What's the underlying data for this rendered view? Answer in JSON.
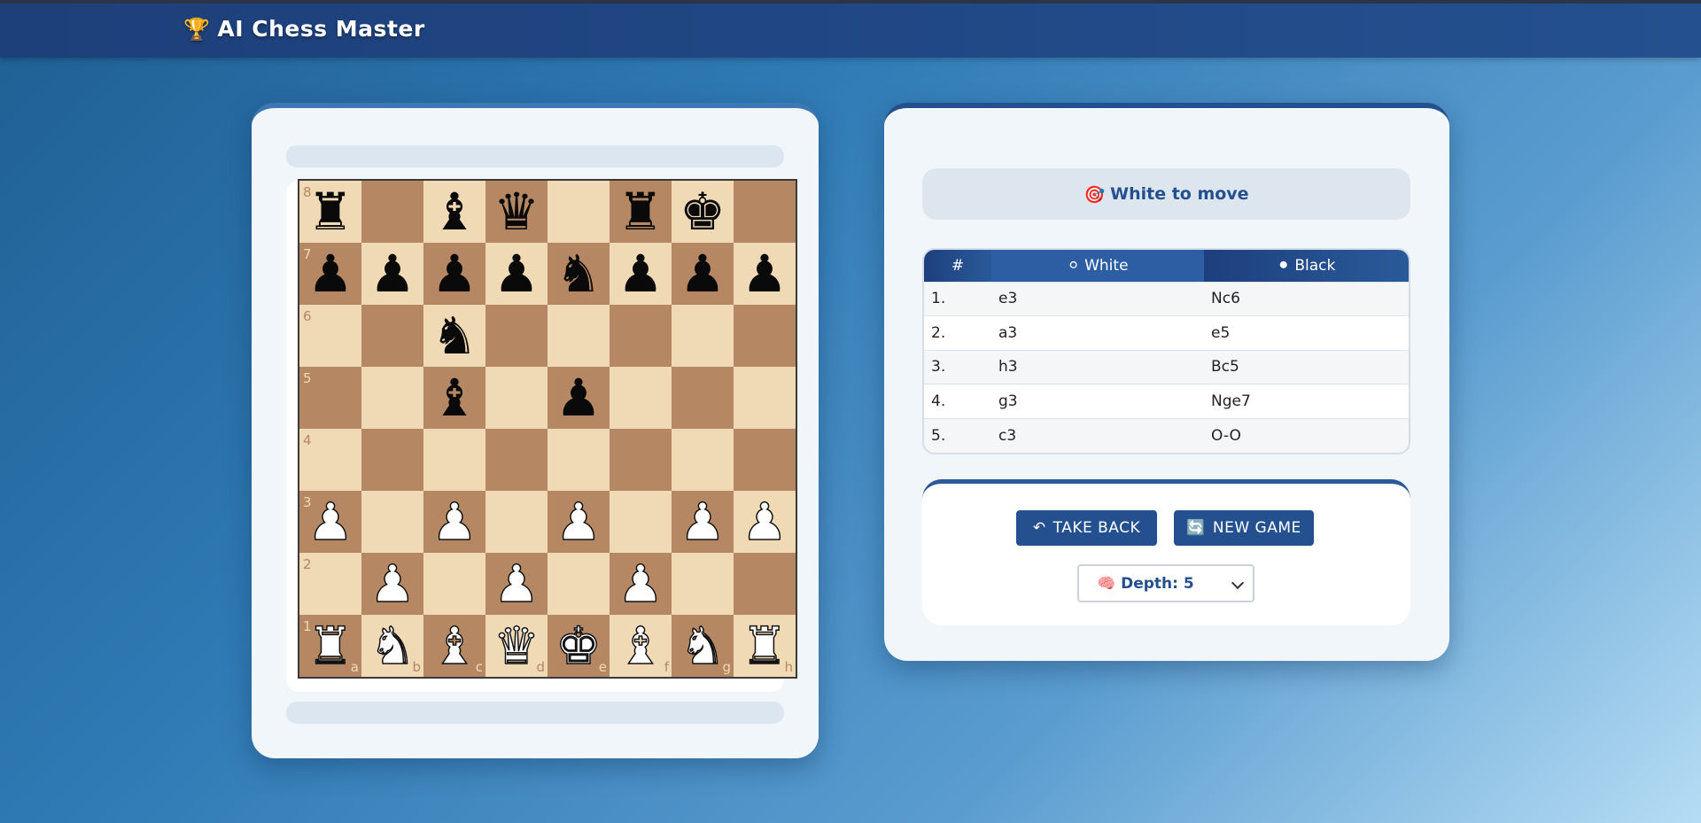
{
  "header": {
    "icon": "🏆",
    "title": "AI Chess Master"
  },
  "status": {
    "icon": "🎯",
    "text": "White to move"
  },
  "moves": {
    "headers": [
      "#",
      "⚪ White",
      "⚫ Black"
    ],
    "rows": [
      {
        "num": "1.",
        "white": "e3",
        "black": "Nc6"
      },
      {
        "num": "2.",
        "white": "a3",
        "black": "e5"
      },
      {
        "num": "3.",
        "white": "h3",
        "black": "Bc5"
      },
      {
        "num": "4.",
        "white": "g3",
        "black": "Nge7"
      },
      {
        "num": "5.",
        "white": "c3",
        "black": "O-O"
      }
    ]
  },
  "controls": {
    "takeback_icon": "↶",
    "takeback_label": "TAKE BACK",
    "newgame_icon": "🔄",
    "newgame_label": "NEW GAME",
    "depth_label": "🧠 Depth: 5"
  },
  "board": {
    "ranks": [
      "8",
      "7",
      "6",
      "5",
      "4",
      "3",
      "2",
      "1"
    ],
    "files": [
      "a",
      "b",
      "c",
      "d",
      "e",
      "f",
      "g",
      "h"
    ],
    "rows": [
      [
        "bR",
        "",
        "bB",
        "bQ",
        "",
        "bR",
        "bK",
        ""
      ],
      [
        "bP",
        "bP",
        "bP",
        "bP",
        "bN",
        "bP",
        "bP",
        "bP"
      ],
      [
        "",
        "",
        "bN",
        "",
        "",
        "",
        "",
        ""
      ],
      [
        "",
        "",
        "bB",
        "",
        "bP",
        "",
        "",
        ""
      ],
      [
        "",
        "",
        "",
        "",
        "",
        "",
        "",
        ""
      ],
      [
        "wP",
        "",
        "wP",
        "",
        "wP",
        "",
        "wP",
        "wP"
      ],
      [
        "",
        "wP",
        "",
        "wP",
        "",
        "wP",
        "",
        ""
      ],
      [
        "wR",
        "wN",
        "wB",
        "wQ",
        "wK",
        "wB",
        "wN",
        "wR"
      ]
    ]
  },
  "colors": {
    "light": "#f0d9b5",
    "dark": "#b58863",
    "accent": "#24508f"
  }
}
